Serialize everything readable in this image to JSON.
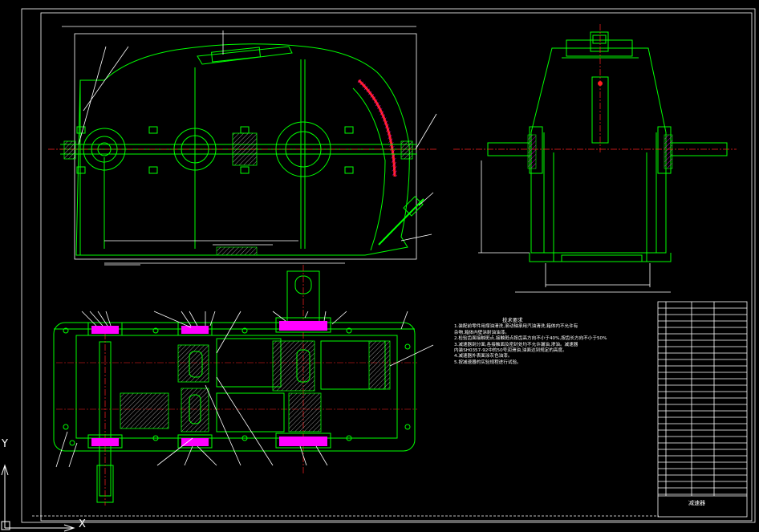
{
  "colors": {
    "background": "#000000",
    "outline": "#00ff00",
    "dimension": "#ffffff",
    "centerline": "#ff2020",
    "hatch": "#ff00ff"
  },
  "technical_notes": {
    "title": "技术要求",
    "items": [
      "1.装配前零件用煤油清洗,滚动轴承用汽油清洗,箱体内不允许有",
      "  杂物,箱体内壁涂耐油油漆。",
      "2.检验齿面接触斑点,接触斑点按齿高方向不小于40%,按齿长方向不小于50%",
      "3.减速器剖分面,各接触面及密封处均不允许漏油,渗油。减速器",
      "  内装SH0357-92中的50号润滑油,油面达到规定的高度。",
      "4.减速器外表面涂灰色油漆。",
      "5.按减速器的实验规程进行试验。"
    ]
  },
  "title_block": {
    "name": "减速器"
  },
  "ucs": {
    "y_label": "Y",
    "x_label": "X"
  }
}
